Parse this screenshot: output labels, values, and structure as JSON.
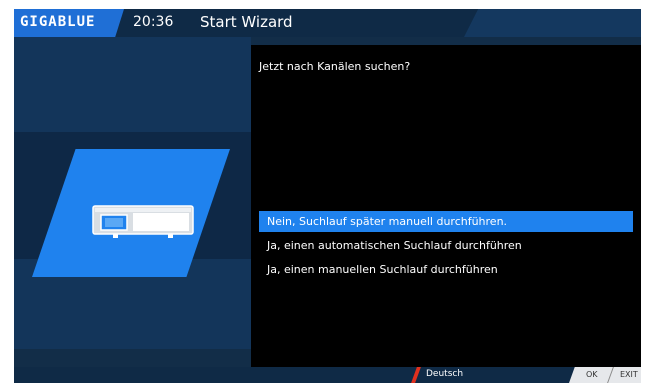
{
  "header": {
    "logo": "GIGABLUE",
    "time": "20:36",
    "title": "Start Wizard"
  },
  "wizard": {
    "question": "Jetzt nach Kanälen suchen?",
    "options": [
      {
        "label": "Nein, Suchlauf später manuell durchführen.",
        "selected": true
      },
      {
        "label": "Ja, einen automatischen Suchlauf durchführen",
        "selected": false
      },
      {
        "label": "Ja, einen manuellen Suchlauf durchführen",
        "selected": false
      }
    ]
  },
  "footer": {
    "language": "Deutsch",
    "key_ok": "OK",
    "key_exit": "EXIT"
  },
  "colors": {
    "accent": "#1f82ee",
    "background": "#122d48",
    "panel": "#000000",
    "language_marker": "#e0301e"
  },
  "icons": {
    "receiver": "set-top-box-icon"
  }
}
